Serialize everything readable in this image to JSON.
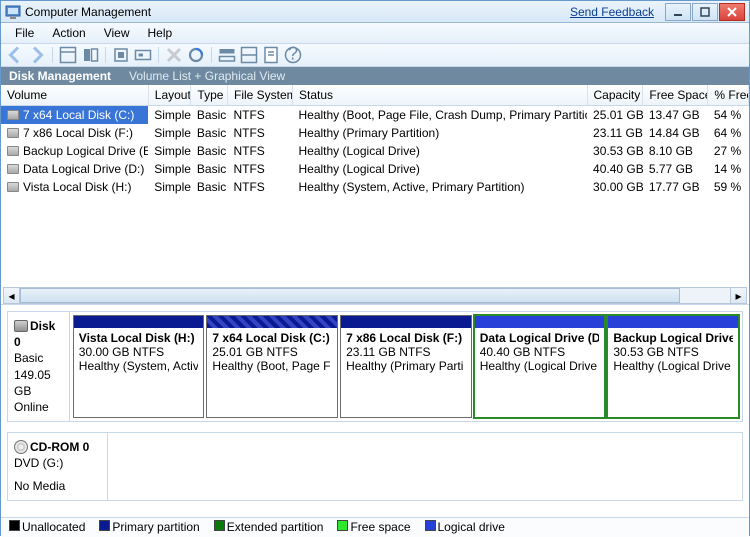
{
  "window": {
    "title": "Computer Management",
    "feedback": "Send Feedback"
  },
  "menu": {
    "file": "File",
    "action": "Action",
    "view": "View",
    "help": "Help"
  },
  "viewbar": {
    "primary": "Disk Management",
    "secondary": "Volume List + Graphical View"
  },
  "columns": {
    "volume": "Volume",
    "layout": "Layout",
    "type": "Type",
    "filesystem": "File System",
    "status": "Status",
    "capacity": "Capacity",
    "freespace": "Free Space",
    "pctfree": "% Free"
  },
  "volumes": [
    {
      "name": "7 x64 Local Disk (C:)",
      "layout": "Simple",
      "type": "Basic",
      "fs": "NTFS",
      "status": "Healthy (Boot, Page File, Crash Dump, Primary Partition)",
      "capacity": "25.01 GB",
      "free": "13.47 GB",
      "pct": "54 %"
    },
    {
      "name": "7 x86 Local Disk (F:)",
      "layout": "Simple",
      "type": "Basic",
      "fs": "NTFS",
      "status": "Healthy (Primary Partition)",
      "capacity": "23.11 GB",
      "free": "14.84 GB",
      "pct": "64 %"
    },
    {
      "name": "Backup Logical Drive (E:)",
      "layout": "Simple",
      "type": "Basic",
      "fs": "NTFS",
      "status": "Healthy (Logical Drive)",
      "capacity": "30.53 GB",
      "free": "8.10 GB",
      "pct": "27 %"
    },
    {
      "name": "Data Logical Drive (D:)",
      "layout": "Simple",
      "type": "Basic",
      "fs": "NTFS",
      "status": "Healthy (Logical Drive)",
      "capacity": "40.40 GB",
      "free": "5.77 GB",
      "pct": "14 %"
    },
    {
      "name": "Vista Local Disk (H:)",
      "layout": "Simple",
      "type": "Basic",
      "fs": "NTFS",
      "status": "Healthy (System, Active, Primary Partition)",
      "capacity": "30.00 GB",
      "free": "17.77 GB",
      "pct": "59 %"
    }
  ],
  "disk0": {
    "name": "Disk 0",
    "type": "Basic",
    "size": "149.05 GB",
    "state": "Online"
  },
  "parts": [
    {
      "name": "Vista Local Disk  (H:)",
      "size": "30.00 GB NTFS",
      "status": "Healthy (System, Activ"
    },
    {
      "name": "7 x64 Local Disk  (C:)",
      "size": "25.01 GB NTFS",
      "status": "Healthy (Boot, Page F"
    },
    {
      "name": "7 x86 Local Disk  (F:)",
      "size": "23.11 GB NTFS",
      "status": "Healthy (Primary Parti"
    },
    {
      "name": "Data Logical Drive  (D",
      "size": "40.40 GB NTFS",
      "status": "Healthy (Logical Drive"
    },
    {
      "name": "Backup Logical Drive",
      "size": "30.53 GB NTFS",
      "status": "Healthy (Logical Drive"
    }
  ],
  "cdrom": {
    "name": "CD-ROM 0",
    "drive": "DVD (G:)",
    "status": "No Media"
  },
  "legend": {
    "unallocated": "Unallocated",
    "primary": "Primary partition",
    "extended": "Extended partition",
    "freespace": "Free space",
    "logical": "Logical drive"
  }
}
